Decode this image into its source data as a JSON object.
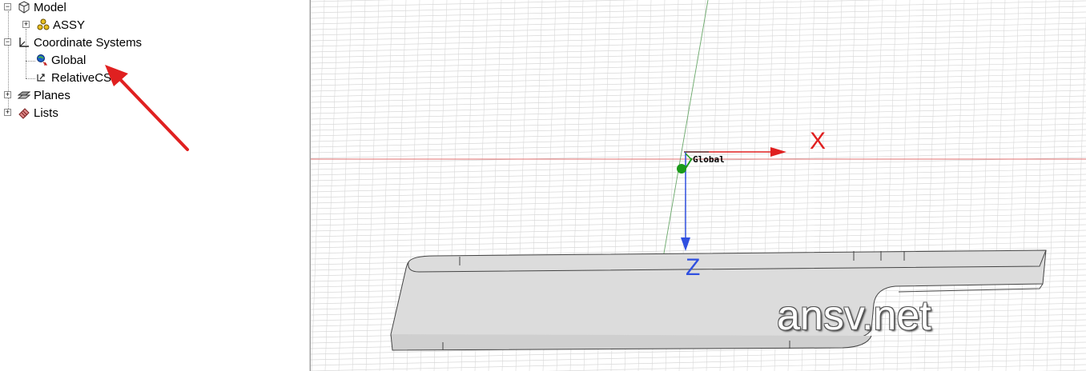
{
  "tree": {
    "model": {
      "label": "Model"
    },
    "assy": {
      "label": "ASSY"
    },
    "coordinate_systems": {
      "label": "Coordinate Systems"
    },
    "global": {
      "label": "Global"
    },
    "relative_cs": {
      "label": "RelativeCS"
    },
    "planes": {
      "label": "Planes"
    },
    "lists": {
      "label": "Lists"
    }
  },
  "viewport": {
    "x_axis_label": "X",
    "z_axis_label": "Z",
    "origin_label": "Global",
    "watermark": "ansv.net"
  },
  "colors": {
    "x_axis": "#e02020",
    "y_axis": "#1a9a1a",
    "z_axis": "#3050e0",
    "annotation_arrow": "#e02020",
    "grid": "#d8d8d8",
    "solid_face": "#dcdcdc"
  },
  "icons": {
    "model": "model-icon",
    "assy": "assembly-icon",
    "coordinate_systems": "coordinate-systems-icon",
    "global": "global-cs-icon",
    "relative_cs": "relative-cs-icon",
    "planes": "planes-icon",
    "lists": "lists-icon"
  }
}
